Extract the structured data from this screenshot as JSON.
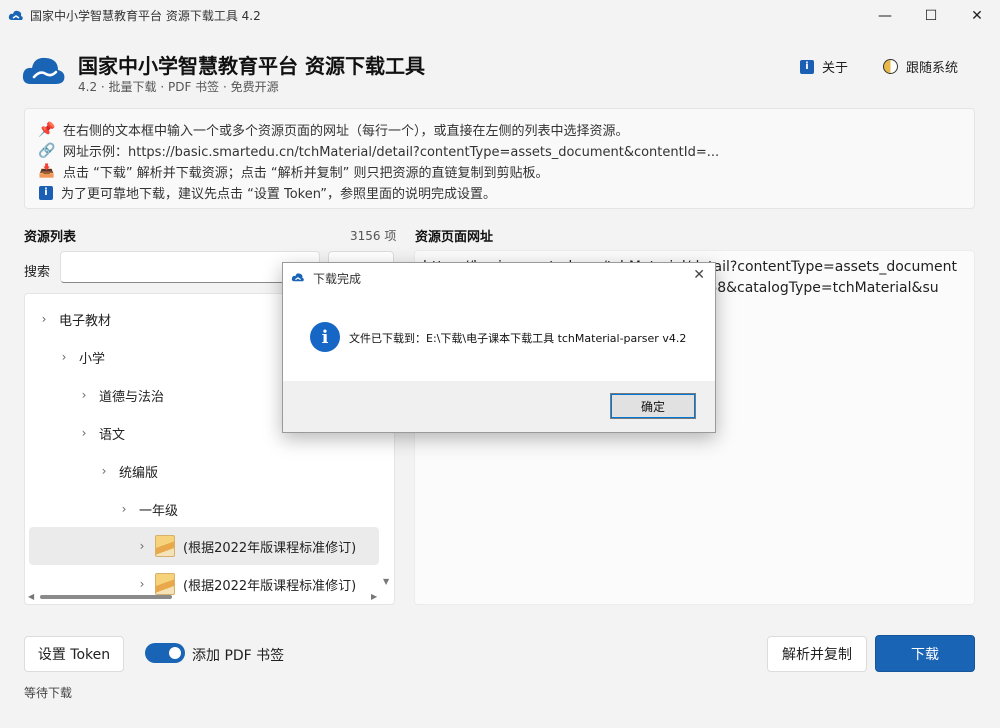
{
  "window": {
    "title": "国家中小学智慧教育平台 资源下载工具 4.2",
    "controls": {
      "minimize": "—",
      "maximize": "☐",
      "close": "✕"
    }
  },
  "header": {
    "title": "国家中小学智慧教育平台 资源下载工具",
    "subtitle": "4.2 · 批量下载 · PDF 书签 · 免费开源",
    "about_label": "关于",
    "theme_label": "跟随系统"
  },
  "tips": [
    {
      "icon": "pushpin-icon",
      "text": "在右侧的文本框中输入一个或多个资源页面的网址（每行一个），或直接在左侧的列表中选择资源。"
    },
    {
      "icon": "link-icon",
      "text": "网址示例：https://basic.smartedu.cn/tchMaterial/detail?contentType=assets_document&contentId=..."
    },
    {
      "icon": "download-tray-icon",
      "text": "点击 “下载” 解析并下载资源；点击 “解析并复制” 则只把资源的直链复制到剪贴板。"
    },
    {
      "icon": "info-icon",
      "text": "为了更可靠地下载，建议先点击 “设置 Token”，参照里面的说明完成设置。"
    }
  ],
  "resource_list": {
    "title": "资源列表",
    "count": "3156 项",
    "search_label": "搜索",
    "search_value": "",
    "search_button": "",
    "tree": [
      {
        "label": "电子教材",
        "level": 0,
        "has_book": false,
        "selected": false
      },
      {
        "label": "小学",
        "level": 1,
        "has_book": false,
        "selected": false
      },
      {
        "label": "道德与法治",
        "level": 2,
        "has_book": false,
        "selected": false
      },
      {
        "label": "语文",
        "level": 2,
        "has_book": false,
        "selected": false
      },
      {
        "label": "统编版",
        "level": 3,
        "has_book": false,
        "selected": false
      },
      {
        "label": "一年级",
        "level": 4,
        "has_book": false,
        "selected": false
      },
      {
        "label": "(根据2022年版课程标准修订)",
        "level": 5,
        "has_book": true,
        "selected": true
      },
      {
        "label": "(根据2022年版课程标准修订)",
        "level": 5,
        "has_book": true,
        "selected": false
      }
    ]
  },
  "url_panel": {
    "title": "资源页面网址",
    "content": "https://basic.smartedu.cn/tchMaterial/detail?contentType=assets_document&con                                                  28268&catalogType=tchMaterial&su"
  },
  "bottom": {
    "token_button": "设置 Token",
    "bookmark_toggle_label": "添加 PDF 书签",
    "bookmark_toggle_on": true,
    "parse_copy_button": "解析并复制",
    "download_button": "下载",
    "status": "等待下载"
  },
  "dialog": {
    "title": "下载完成",
    "message": "文件已下载到：E:\\下载\\电子课本下载工具 tchMaterial-parser v4.2",
    "ok_button": "确定",
    "close_glyph": "✕"
  },
  "colors": {
    "accent": "#1a64b5",
    "info_blue": "#1666c5"
  }
}
